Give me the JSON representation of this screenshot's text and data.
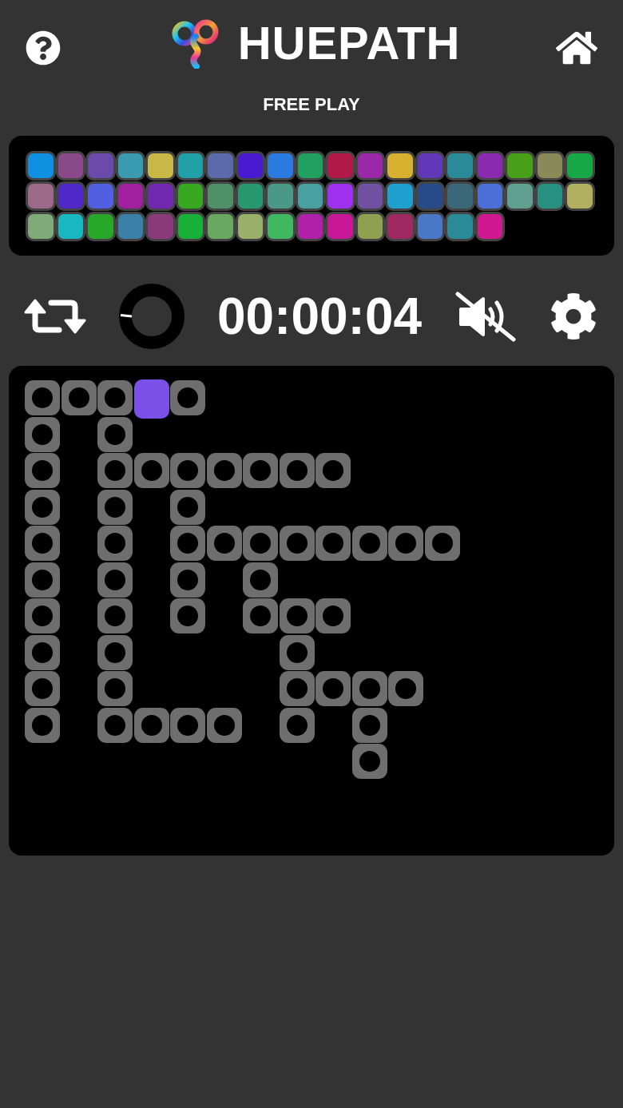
{
  "header": {
    "title": "HUEPATH",
    "mode": "FREE PLAY"
  },
  "palette": {
    "rows": [
      [
        {
          "color": "#1090e0"
        },
        {
          "color": "#8a4a8a"
        },
        {
          "color": "#6a4aaa"
        },
        {
          "color": "#3a9ab0"
        },
        {
          "color": "#c8b848"
        },
        {
          "color": "#22a0a8"
        },
        {
          "color": "#5a6aaa"
        },
        {
          "color": "#4a1ad0"
        },
        {
          "color": "#2a7ae0"
        },
        {
          "color": "#22a060"
        },
        {
          "color": "#b01a48"
        },
        {
          "color": "#9a28a8"
        },
        {
          "color": "#d8b030"
        },
        {
          "color": "#6038b8"
        },
        {
          "color": "#2a8a98"
        },
        {
          "color": "#8a2ab0"
        },
        {
          "color": "#48a018"
        },
        {
          "color": "#8a8a58"
        },
        {
          "color": "#18a848"
        }
      ],
      [
        {
          "color": "#9a6a88"
        },
        {
          "color": "#5028c8"
        },
        {
          "color": "#5060e0"
        },
        {
          "color": "#a020a0"
        },
        {
          "color": "#7028b0"
        },
        {
          "color": "#38a820"
        },
        {
          "color": "#509068"
        },
        {
          "color": "#289870"
        },
        {
          "color": "#4a9888"
        },
        {
          "color": "#48a0a0"
        },
        {
          "color": "#a030f0"
        },
        {
          "color": "#7050a0"
        },
        {
          "color": "#20a0d0"
        },
        {
          "color": "#284a88"
        },
        {
          "color": "#3a6878"
        },
        {
          "color": "#4a70d8"
        },
        {
          "color": "#60a090"
        },
        {
          "color": "#289080"
        },
        {
          "color": "#b0b060"
        }
      ],
      [
        {
          "color": "#80aa78"
        },
        {
          "color": "#18b8c0"
        },
        {
          "color": "#28a828"
        },
        {
          "color": "#3a80a8"
        },
        {
          "color": "#8a3a78"
        },
        {
          "color": "#18b038"
        },
        {
          "color": "#68a860"
        },
        {
          "color": "#98b068"
        },
        {
          "color": "#40b860"
        },
        {
          "color": "#b020a8"
        },
        {
          "color": "#c81898"
        },
        {
          "color": "#90a050"
        },
        {
          "color": "#a02860"
        },
        {
          "color": "#4a78c8"
        },
        {
          "color": "#2a8a98"
        },
        {
          "color": "#d01890"
        }
      ]
    ]
  },
  "toolbar": {
    "timer": "00:00:04",
    "muted": true
  },
  "board": {
    "rows": [
      [
        {
          "kind": "slot"
        },
        {
          "kind": "slot"
        },
        {
          "kind": "slot"
        },
        {
          "kind": "tile",
          "color": "#7a50e8"
        },
        {
          "kind": "slot"
        }
      ],
      [
        {
          "kind": "slot"
        },
        {
          "kind": "gap"
        },
        {
          "kind": "slot"
        }
      ],
      [
        {
          "kind": "slot"
        },
        {
          "kind": "gap"
        },
        {
          "kind": "slot"
        },
        {
          "kind": "slot"
        },
        {
          "kind": "slot"
        },
        {
          "kind": "slot"
        },
        {
          "kind": "slot"
        },
        {
          "kind": "slot"
        },
        {
          "kind": "slot"
        }
      ],
      [
        {
          "kind": "slot"
        },
        {
          "kind": "gap"
        },
        {
          "kind": "slot"
        },
        {
          "kind": "gap"
        },
        {
          "kind": "slot"
        }
      ],
      [
        {
          "kind": "slot"
        },
        {
          "kind": "gap"
        },
        {
          "kind": "slot"
        },
        {
          "kind": "gap"
        },
        {
          "kind": "slot"
        },
        {
          "kind": "slot"
        },
        {
          "kind": "slot"
        },
        {
          "kind": "slot"
        },
        {
          "kind": "slot"
        },
        {
          "kind": "slot"
        },
        {
          "kind": "slot"
        },
        {
          "kind": "slot"
        }
      ],
      [
        {
          "kind": "slot"
        },
        {
          "kind": "gap"
        },
        {
          "kind": "slot"
        },
        {
          "kind": "gap"
        },
        {
          "kind": "slot"
        },
        {
          "kind": "gap"
        },
        {
          "kind": "slot"
        }
      ],
      [
        {
          "kind": "slot"
        },
        {
          "kind": "gap"
        },
        {
          "kind": "slot"
        },
        {
          "kind": "gap"
        },
        {
          "kind": "slot"
        },
        {
          "kind": "gap"
        },
        {
          "kind": "slot"
        },
        {
          "kind": "slot"
        },
        {
          "kind": "slot"
        }
      ],
      [
        {
          "kind": "slot"
        },
        {
          "kind": "gap"
        },
        {
          "kind": "slot"
        },
        {
          "kind": "gap"
        },
        {
          "kind": "gap"
        },
        {
          "kind": "gap"
        },
        {
          "kind": "gap"
        },
        {
          "kind": "slot"
        }
      ],
      [
        {
          "kind": "slot"
        },
        {
          "kind": "gap"
        },
        {
          "kind": "slot"
        },
        {
          "kind": "gap"
        },
        {
          "kind": "gap"
        },
        {
          "kind": "gap"
        },
        {
          "kind": "gap"
        },
        {
          "kind": "slot"
        },
        {
          "kind": "slot"
        },
        {
          "kind": "slot"
        },
        {
          "kind": "slot"
        }
      ],
      [
        {
          "kind": "slot"
        },
        {
          "kind": "gap"
        },
        {
          "kind": "slot"
        },
        {
          "kind": "slot"
        },
        {
          "kind": "slot"
        },
        {
          "kind": "slot"
        },
        {
          "kind": "gap"
        },
        {
          "kind": "slot"
        },
        {
          "kind": "gap"
        },
        {
          "kind": "slot"
        }
      ],
      [
        {
          "kind": "gap"
        },
        {
          "kind": "gap"
        },
        {
          "kind": "gap"
        },
        {
          "kind": "gap"
        },
        {
          "kind": "gap"
        },
        {
          "kind": "gap"
        },
        {
          "kind": "gap"
        },
        {
          "kind": "gap"
        },
        {
          "kind": "gap"
        },
        {
          "kind": "slot"
        }
      ]
    ]
  }
}
